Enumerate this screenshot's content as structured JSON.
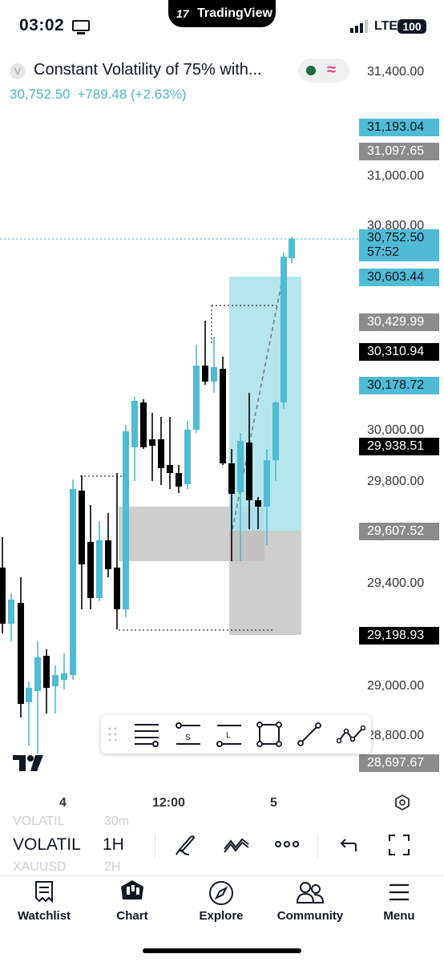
{
  "status_bar": {
    "time": "03:02",
    "app_pill": "TradingView",
    "network": "LTE",
    "battery": "100"
  },
  "header": {
    "symbol_initial": "V",
    "title": "Constant Volatility of 75% with...",
    "price": "30,752.50",
    "change": "+789.48 (+2.63%)"
  },
  "price_axis": {
    "labels": [
      "31,400.00",
      "31,000.00",
      "30,800.00",
      "30,000.00",
      "29,800.00",
      "29,400.00",
      "29,000.00",
      "28,800.00"
    ],
    "tags": [
      {
        "text": "31,193.04",
        "style": "blue"
      },
      {
        "text": "31,097.65",
        "style": "gray"
      },
      {
        "text": "30,752.50",
        "sub": "57:52",
        "style": "blue"
      },
      {
        "text": "30,603.44",
        "style": "blue"
      },
      {
        "text": "30,429.99",
        "style": "gray"
      },
      {
        "text": "30,310.94",
        "style": "black"
      },
      {
        "text": "30,178.72",
        "style": "blue"
      },
      {
        "text": "29,938.51",
        "style": "black"
      },
      {
        "text": "29,607.52",
        "style": "gray"
      },
      {
        "text": "29,198.93",
        "style": "black"
      },
      {
        "text": "28,697.67",
        "style": "gray"
      }
    ]
  },
  "time_axis": {
    "labels": [
      "4",
      "12:00",
      "5"
    ]
  },
  "drawing_toolbar": {
    "tools": [
      "horizontal-lines-icon",
      "short-position-icon",
      "long-position-icon",
      "rectangle-icon",
      "trend-line-icon",
      "path-icon"
    ],
    "tool_letters": {
      "short": "S",
      "long": "L"
    }
  },
  "controls": {
    "symbol": "VOLATIL",
    "interval": "1H",
    "ghost_above_symbol": "VOLATIL",
    "ghost_above_interval": "30m",
    "ghost_below_symbol": "XAUUSD",
    "ghost_below_interval": "2H"
  },
  "tabs": [
    {
      "label": "Watchlist",
      "icon": "watchlist-icon"
    },
    {
      "label": "Chart",
      "icon": "chart-icon"
    },
    {
      "label": "Explore",
      "icon": "compass-icon"
    },
    {
      "label": "Community",
      "icon": "community-icon"
    },
    {
      "label": "Menu",
      "icon": "menu-icon"
    }
  ],
  "colors": {
    "bull": "#4fbbd4",
    "bear": "#000000",
    "accent": "#4db6c9",
    "zone_gray": "#bdbdbd",
    "zone_blue": "#a8e0ea"
  }
}
